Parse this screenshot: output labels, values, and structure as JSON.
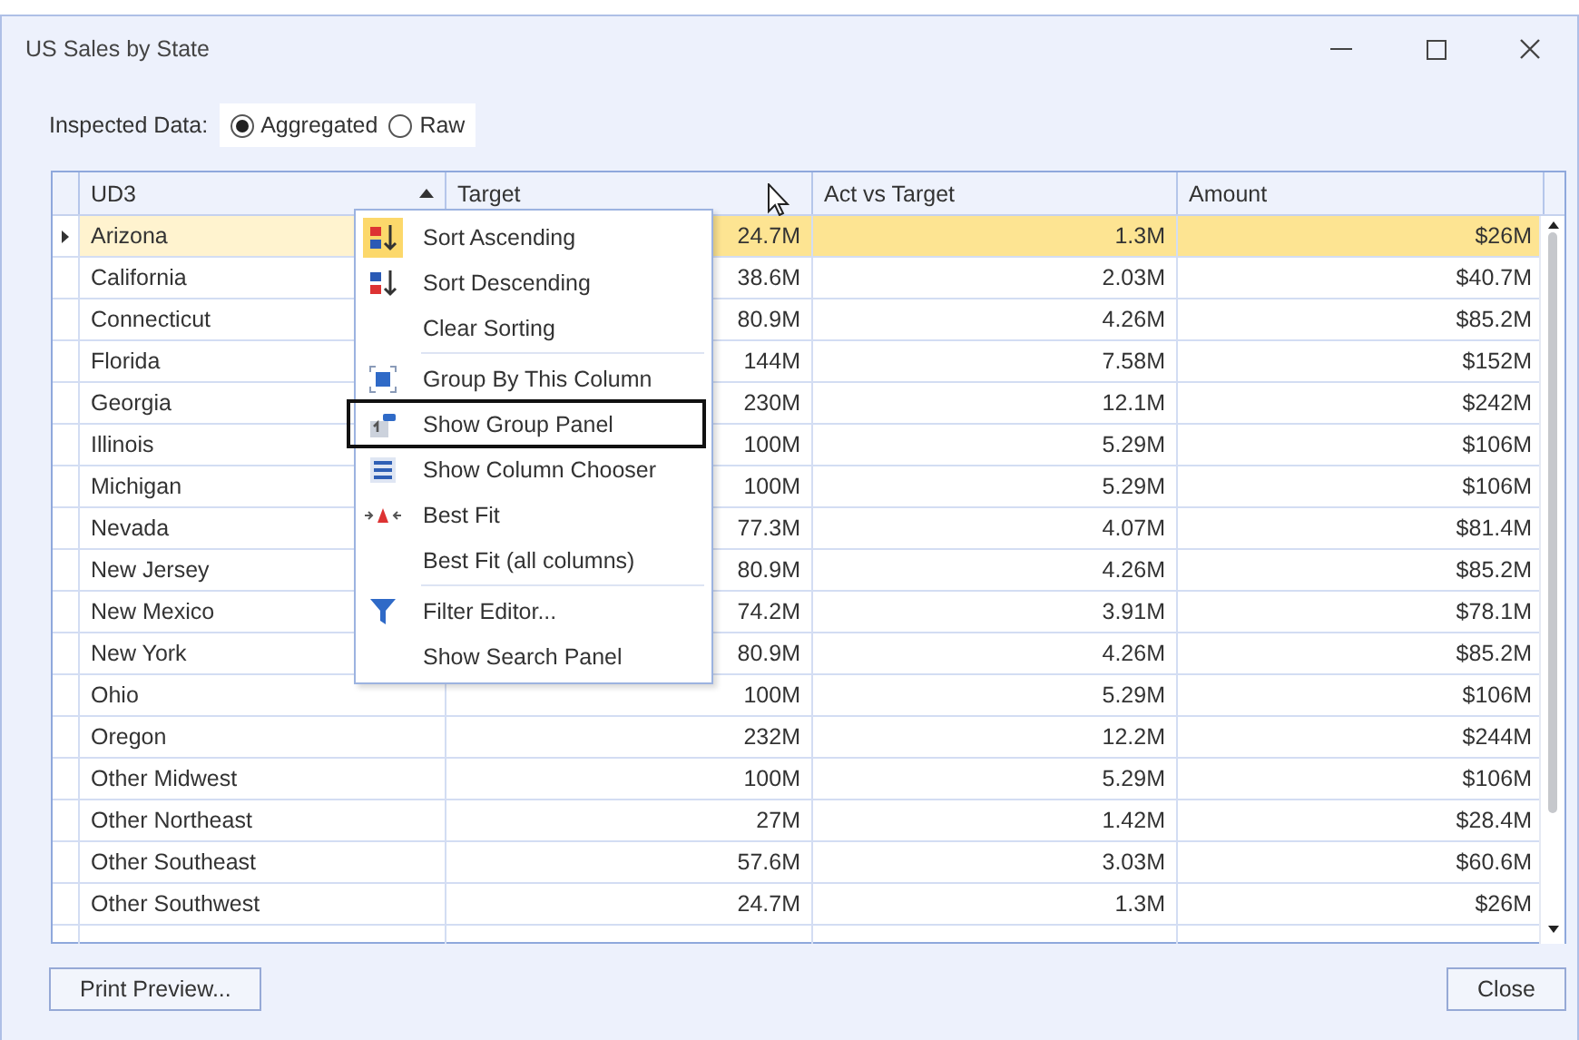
{
  "window": {
    "title": "US Sales by State"
  },
  "inspected_data": {
    "label": "Inspected Data:",
    "options": [
      {
        "label": "Aggregated",
        "selected": true
      },
      {
        "label": "Raw",
        "selected": false
      }
    ]
  },
  "grid": {
    "columns": [
      {
        "label": "UD3",
        "sorted": true
      },
      {
        "label": "Target",
        "sorted": false
      },
      {
        "label": "Act vs Target",
        "sorted": false
      },
      {
        "label": "Amount",
        "sorted": false
      }
    ],
    "rows": [
      {
        "cells": [
          "Arizona",
          "24.7M",
          "1.3M",
          "$26M"
        ],
        "selected": true
      },
      {
        "cells": [
          "California",
          "38.6M",
          "2.03M",
          "$40.7M"
        ],
        "selected": false
      },
      {
        "cells": [
          "Connecticut",
          "80.9M",
          "4.26M",
          "$85.2M"
        ],
        "selected": false
      },
      {
        "cells": [
          "Florida",
          "144M",
          "7.58M",
          "$152M"
        ],
        "selected": false
      },
      {
        "cells": [
          "Georgia",
          "230M",
          "12.1M",
          "$242M"
        ],
        "selected": false
      },
      {
        "cells": [
          "Illinois",
          "100M",
          "5.29M",
          "$106M"
        ],
        "selected": false
      },
      {
        "cells": [
          "Michigan",
          "100M",
          "5.29M",
          "$106M"
        ],
        "selected": false
      },
      {
        "cells": [
          "Nevada",
          "77.3M",
          "4.07M",
          "$81.4M"
        ],
        "selected": false
      },
      {
        "cells": [
          "New Jersey",
          "80.9M",
          "4.26M",
          "$85.2M"
        ],
        "selected": false
      },
      {
        "cells": [
          "New Mexico",
          "74.2M",
          "3.91M",
          "$78.1M"
        ],
        "selected": false
      },
      {
        "cells": [
          "New York",
          "80.9M",
          "4.26M",
          "$85.2M"
        ],
        "selected": false
      },
      {
        "cells": [
          "Ohio",
          "100M",
          "5.29M",
          "$106M"
        ],
        "selected": false
      },
      {
        "cells": [
          "Oregon",
          "232M",
          "12.2M",
          "$244M"
        ],
        "selected": false
      },
      {
        "cells": [
          "Other Midwest",
          "100M",
          "5.29M",
          "$106M"
        ],
        "selected": false
      },
      {
        "cells": [
          "Other Northeast",
          "27M",
          "1.42M",
          "$28.4M"
        ],
        "selected": false
      },
      {
        "cells": [
          "Other Southeast",
          "57.6M",
          "3.03M",
          "$60.6M"
        ],
        "selected": false
      },
      {
        "cells": [
          "Other Southwest",
          "24.7M",
          "1.3M",
          "$26M"
        ],
        "selected": false
      }
    ]
  },
  "context_menu": {
    "items": [
      {
        "label": "Sort Ascending",
        "kind": "sort-ascending",
        "highlighted": true,
        "outlined": false,
        "separator_before": false
      },
      {
        "label": "Sort Descending",
        "kind": "sort-descending",
        "highlighted": false,
        "outlined": false,
        "separator_before": false
      },
      {
        "label": "Clear Sorting",
        "kind": "plain",
        "highlighted": false,
        "outlined": false,
        "separator_before": false
      },
      {
        "label": "Group By This Column",
        "kind": "group",
        "highlighted": false,
        "outlined": false,
        "separator_before": true
      },
      {
        "label": "Show Group Panel",
        "kind": "group-panel",
        "highlighted": false,
        "outlined": true,
        "separator_before": false
      },
      {
        "label": "Show Column Chooser",
        "kind": "column-chooser",
        "highlighted": false,
        "outlined": false,
        "separator_before": false
      },
      {
        "label": "Best Fit",
        "kind": "best-fit",
        "highlighted": false,
        "outlined": false,
        "separator_before": false
      },
      {
        "label": "Best Fit (all columns)",
        "kind": "plain",
        "highlighted": false,
        "outlined": false,
        "separator_before": false
      },
      {
        "label": "Filter Editor...",
        "kind": "filter",
        "highlighted": false,
        "outlined": false,
        "separator_before": true
      },
      {
        "label": "Show Search Panel",
        "kind": "plain",
        "highlighted": false,
        "outlined": false,
        "separator_before": false
      }
    ]
  },
  "buttons": {
    "left": "Print Preview...",
    "right": "Close"
  }
}
